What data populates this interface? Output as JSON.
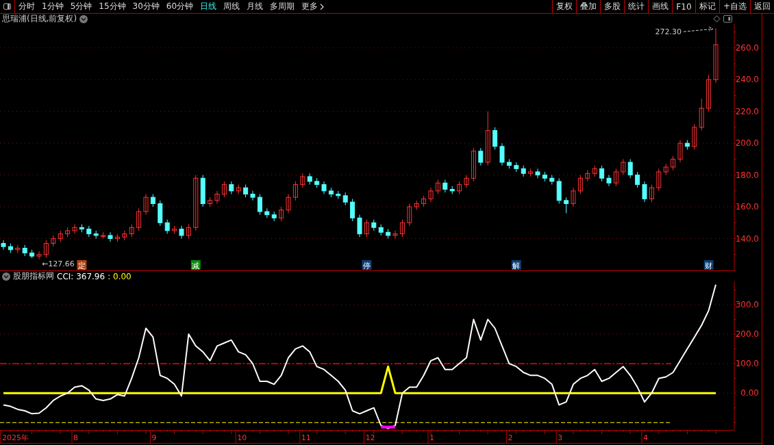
{
  "toolbar": {
    "periods": [
      {
        "label": "分时",
        "selected": false
      },
      {
        "label": "1分钟",
        "selected": false
      },
      {
        "label": "5分钟",
        "selected": false
      },
      {
        "label": "15分钟",
        "selected": false
      },
      {
        "label": "30分钟",
        "selected": false
      },
      {
        "label": "60分钟",
        "selected": false
      },
      {
        "label": "日线",
        "selected": true
      },
      {
        "label": "周线",
        "selected": false
      },
      {
        "label": "月线",
        "selected": false
      },
      {
        "label": "多周期",
        "selected": false
      },
      {
        "label": "更多",
        "selected": false
      }
    ],
    "buttons": [
      "复权",
      "叠加",
      "多股",
      "统计",
      "画线",
      "F10",
      "标记",
      "+自选",
      "返回"
    ]
  },
  "price_panel": {
    "title": "思瑞浦(日线,前复权)",
    "events": [
      {
        "text": "定",
        "color": "#b5420f"
      },
      {
        "text": "减",
        "color": "#0b8a0b"
      },
      {
        "text": "停",
        "color": "#0d3f73"
      },
      {
        "text": "解",
        "color": "#0d3f73"
      },
      {
        "text": "财",
        "color": "#0d3f73"
      }
    ],
    "chart_data": {
      "type": "candlestick",
      "grid": true,
      "ylim": [
        120,
        275
      ],
      "yticks": [
        {
          "value": 140,
          "label": "140.0"
        },
        {
          "value": 160,
          "label": "160.0"
        },
        {
          "value": 180,
          "label": "180.0"
        },
        {
          "value": 200,
          "label": "200.0"
        },
        {
          "value": 220,
          "label": "220.0"
        },
        {
          "value": 240,
          "label": "240.0"
        },
        {
          "value": 260,
          "label": "260.0"
        }
      ],
      "ohlc": [
        [
          137,
          139,
          133,
          135
        ],
        [
          135,
          137,
          131,
          133
        ],
        [
          133,
          136,
          131,
          134
        ],
        [
          134,
          136,
          129,
          131
        ],
        [
          131,
          133,
          127.66,
          129
        ],
        [
          129,
          132,
          127,
          130
        ],
        [
          130,
          139,
          128,
          137
        ],
        [
          137,
          142,
          135,
          140
        ],
        [
          140,
          145,
          138,
          143
        ],
        [
          143,
          147,
          141,
          145
        ],
        [
          145,
          149,
          143,
          147
        ],
        [
          147,
          149,
          144,
          146
        ],
        [
          146,
          148,
          141,
          143
        ],
        [
          143,
          145,
          140,
          142
        ],
        [
          142,
          144,
          140,
          142
        ],
        [
          142,
          144,
          138,
          140
        ],
        [
          140,
          143,
          138,
          141
        ],
        [
          141,
          145,
          139,
          143
        ],
        [
          143,
          149,
          141,
          147
        ],
        [
          147,
          159,
          145,
          157
        ],
        [
          157,
          168,
          155,
          166
        ],
        [
          166,
          168,
          160,
          162
        ],
        [
          162,
          164,
          148,
          150
        ],
        [
          150,
          152,
          143,
          145
        ],
        [
          145,
          148,
          143,
          146
        ],
        [
          146,
          148,
          140,
          142
        ],
        [
          142,
          149,
          140,
          147
        ],
        [
          147,
          180,
          145,
          178
        ],
        [
          178,
          180,
          160,
          162
        ],
        [
          162,
          166,
          160,
          164
        ],
        [
          164,
          170,
          162,
          168
        ],
        [
          168,
          176,
          166,
          174
        ],
        [
          174,
          176,
          168,
          170
        ],
        [
          170,
          174,
          168,
          172
        ],
        [
          172,
          174,
          166,
          168
        ],
        [
          168,
          170,
          164,
          166
        ],
        [
          166,
          168,
          155,
          157
        ],
        [
          157,
          159,
          153,
          155
        ],
        [
          155,
          157,
          151,
          153
        ],
        [
          153,
          160,
          151,
          158
        ],
        [
          158,
          168,
          156,
          166
        ],
        [
          166,
          176,
          164,
          174
        ],
        [
          174,
          181,
          172,
          179
        ],
        [
          179,
          181,
          174,
          176
        ],
        [
          176,
          178,
          172,
          174
        ],
        [
          174,
          176,
          168,
          170
        ],
        [
          170,
          172,
          166,
          168
        ],
        [
          168,
          170,
          165,
          167
        ],
        [
          167,
          169,
          161,
          163
        ],
        [
          163,
          165,
          151,
          153
        ],
        [
          153,
          155,
          141,
          143
        ],
        [
          143,
          152,
          141,
          150
        ],
        [
          150,
          152,
          145,
          147
        ],
        [
          147,
          149,
          142,
          144
        ],
        [
          144,
          146,
          140,
          142
        ],
        [
          142,
          145,
          140,
          143
        ],
        [
          143,
          152,
          141,
          150
        ],
        [
          150,
          162,
          148,
          160
        ],
        [
          160,
          164,
          158,
          162
        ],
        [
          162,
          167,
          160,
          165
        ],
        [
          165,
          172,
          163,
          170
        ],
        [
          170,
          177,
          168,
          175
        ],
        [
          175,
          177,
          169,
          171
        ],
        [
          171,
          173,
          168,
          170
        ],
        [
          170,
          176,
          168,
          174
        ],
        [
          174,
          180,
          172,
          178
        ],
        [
          178,
          197,
          176,
          195
        ],
        [
          195,
          197,
          186,
          188
        ],
        [
          188,
          220,
          186,
          208
        ],
        [
          208,
          210,
          196,
          198
        ],
        [
          198,
          200,
          186,
          188
        ],
        [
          188,
          190,
          184,
          186
        ],
        [
          186,
          188,
          182,
          184
        ],
        [
          184,
          186,
          179,
          181
        ],
        [
          181,
          184,
          179,
          182
        ],
        [
          182,
          184,
          178,
          180
        ],
        [
          180,
          182,
          176,
          178
        ],
        [
          178,
          180,
          174,
          176
        ],
        [
          176,
          178,
          162,
          164
        ],
        [
          164,
          166,
          156,
          162
        ],
        [
          162,
          172,
          160,
          170
        ],
        [
          170,
          180,
          168,
          178
        ],
        [
          178,
          183,
          176,
          181
        ],
        [
          181,
          186,
          179,
          184
        ],
        [
          184,
          186,
          176,
          178
        ],
        [
          178,
          180,
          173,
          175
        ],
        [
          175,
          184,
          173,
          182
        ],
        [
          182,
          190,
          180,
          188
        ],
        [
          188,
          190,
          178,
          180
        ],
        [
          180,
          182,
          172,
          174
        ],
        [
          174,
          176,
          163,
          165
        ],
        [
          165,
          174,
          163,
          172
        ],
        [
          172,
          184,
          170,
          182
        ],
        [
          182,
          187,
          180,
          185
        ],
        [
          185,
          192,
          183,
          190
        ],
        [
          190,
          202,
          188,
          200
        ],
        [
          200,
          202,
          196,
          198
        ],
        [
          198,
          212,
          196,
          210
        ],
        [
          210,
          228,
          208,
          222
        ],
        [
          222,
          243,
          220,
          240
        ],
        [
          240,
          272.3,
          238,
          262
        ]
      ],
      "annotations": [
        {
          "text": "←127.66"
        },
        {
          "text": "272.30"
        }
      ]
    }
  },
  "indicator_panel": {
    "title": "股朋指标网",
    "legend": [
      {
        "text": ": 367.96"
      },
      {
        "text": ": 0.00"
      }
    ],
    "chart_data": {
      "type": "line",
      "grid": true,
      "ylim": [
        -125,
        379
      ],
      "yticks": [
        {
          "value": 0,
          "label": "0.00"
        },
        {
          "value": 100,
          "label": "100.0"
        },
        {
          "value": 200,
          "label": "200.0"
        },
        {
          "value": 300,
          "label": "300.0"
        }
      ],
      "series": [
        {
          "name": "CCI",
          "color": "#ffffff",
          "values": [
            -40,
            -45,
            -55,
            -60,
            -70,
            -68,
            -50,
            -25,
            -10,
            0,
            20,
            25,
            10,
            -20,
            -25,
            -20,
            -5,
            -10,
            50,
            120,
            220,
            190,
            60,
            50,
            30,
            -10,
            200,
            160,
            140,
            110,
            160,
            170,
            180,
            140,
            130,
            100,
            40,
            40,
            30,
            60,
            120,
            150,
            160,
            140,
            90,
            80,
            60,
            40,
            10,
            -60,
            -70,
            -60,
            -50,
            -110,
            -120,
            -110,
            0,
            20,
            20,
            60,
            110,
            120,
            80,
            80,
            100,
            120,
            250,
            180,
            250,
            220,
            160,
            100,
            90,
            70,
            60,
            60,
            50,
            30,
            -40,
            -30,
            30,
            50,
            60,
            80,
            40,
            50,
            70,
            90,
            60,
            20,
            -30,
            0,
            50,
            55,
            70,
            110,
            150,
            190,
            230,
            280,
            368
          ]
        },
        {
          "color": "#ffff00",
          "values": [
            0,
            0,
            0,
            0,
            0,
            0,
            0,
            0,
            0,
            0,
            0,
            0,
            0,
            0,
            0,
            0,
            0,
            0,
            0,
            0,
            0,
            0,
            0,
            0,
            0,
            0,
            0,
            0,
            0,
            0,
            0,
            0,
            0,
            0,
            0,
            0,
            0,
            0,
            0,
            0,
            0,
            0,
            0,
            0,
            0,
            0,
            0,
            0,
            0,
            0,
            0,
            0,
            0,
            0,
            90,
            0,
            0,
            0,
            0,
            0,
            0,
            0,
            0,
            0,
            0,
            0,
            0,
            0,
            0,
            0,
            0,
            0,
            0,
            0,
            0,
            0,
            0,
            0,
            0,
            0,
            0,
            0,
            0,
            0,
            0,
            0,
            0,
            0,
            0,
            0,
            0,
            0,
            0,
            0,
            0,
            0,
            0,
            0,
            0,
            0,
            0
          ]
        }
      ],
      "ref_lines": [
        {
          "axis": "y",
          "value": 100
        },
        {
          "axis": "y",
          "value": -100
        }
      ]
    },
    "date_axis": [
      "2025年",
      "8",
      "9",
      "10",
      "11",
      "12",
      "1",
      "2",
      "3",
      "4"
    ]
  }
}
